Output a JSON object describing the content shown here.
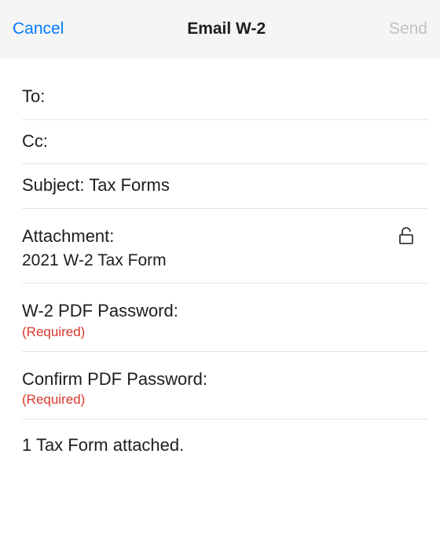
{
  "header": {
    "cancel": "Cancel",
    "title": "Email W-2",
    "send": "Send"
  },
  "fields": {
    "to_label": "To:",
    "cc_label": "Cc:",
    "subject_label": "Subject: Tax Forms",
    "attachment_label": "Attachment:",
    "attachment_name": "2021 W-2 Tax Form",
    "password_label": "W-2 PDF Password:",
    "password_required": "(Required)",
    "confirm_label": "Confirm PDF Password:",
    "confirm_required": "(Required)"
  },
  "body": {
    "attached_text": "1 Tax Form attached."
  }
}
